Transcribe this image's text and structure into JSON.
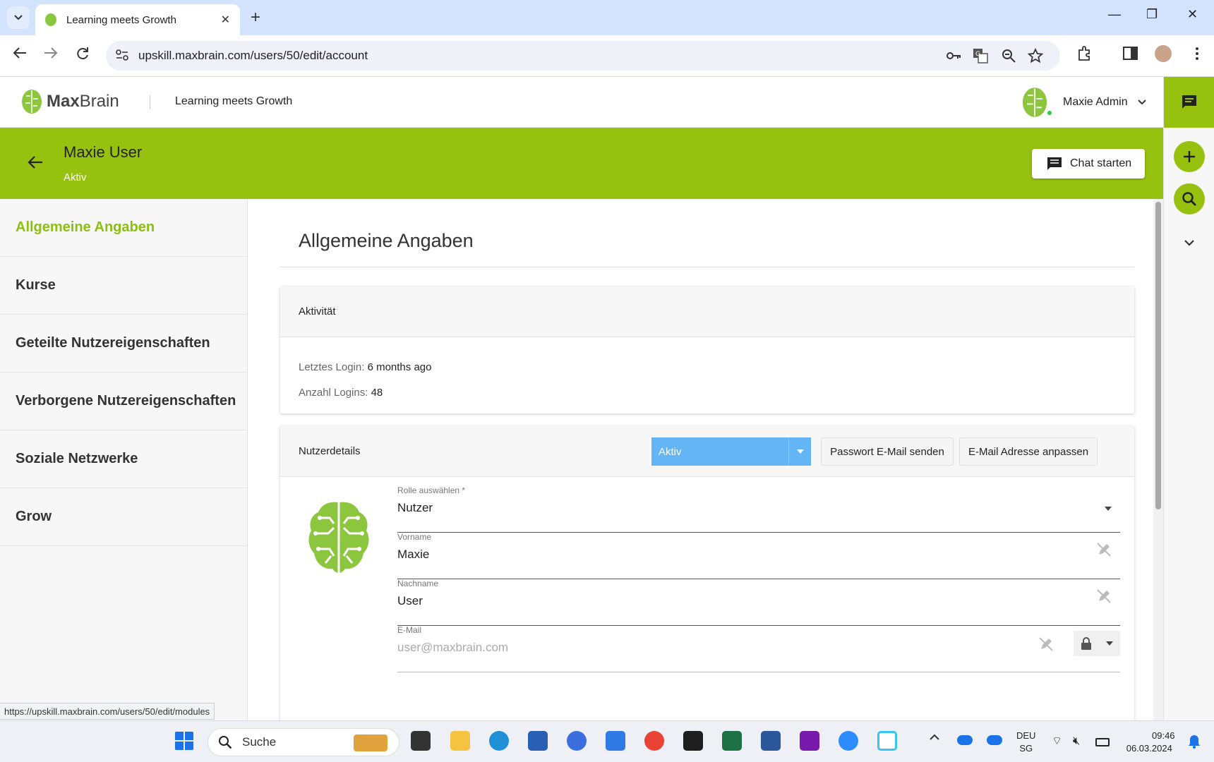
{
  "browser": {
    "tab_title": "Learning meets Growth",
    "url": "upskill.maxbrain.com/users/50/edit/account",
    "status_url": "https://upskill.maxbrain.com/users/50/edit/modules"
  },
  "header": {
    "logo_bold": "Max",
    "logo_rest": "Brain",
    "title": "Learning meets Growth",
    "user_name": "Maxie Admin"
  },
  "banner": {
    "name": "Maxie User",
    "status": "Aktiv",
    "chat_button": "Chat starten"
  },
  "sidebar": {
    "items": [
      {
        "label": "Allgemeine Angaben"
      },
      {
        "label": "Kurse"
      },
      {
        "label": "Geteilte Nutzereigenschaften"
      },
      {
        "label": "Verborgene Nutzereigenschaften"
      },
      {
        "label": "Soziale Netzwerke"
      },
      {
        "label": "Grow"
      }
    ]
  },
  "main": {
    "title": "Allgemeine Angaben",
    "activity": {
      "heading": "Aktivität",
      "last_login_label": "Letztes Login:",
      "last_login_value": "6 months ago",
      "login_count_label": "Anzahl Logins:",
      "login_count_value": "48"
    },
    "details": {
      "heading": "Nutzerdetails",
      "status_select": "Aktiv",
      "send_password_button": "Passwort E-Mail senden",
      "change_email_button": "E-Mail Adresse anpassen",
      "role_label": "Rolle auswählen *",
      "role_value": "Nutzer",
      "firstname_label": "Vorname",
      "firstname_value": "Maxie",
      "lastname_label": "Nachname",
      "lastname_value": "User",
      "email_label": "E-Mail",
      "email_value": "user@maxbrain.com"
    }
  },
  "taskbar": {
    "search_placeholder": "Suche",
    "lang_top": "DEU",
    "lang_bottom": "SG",
    "time": "09:46",
    "date": "06.03.2024"
  },
  "colors": {
    "brand_green": "#97c10f",
    "active_link": "#8cbf10",
    "select_blue": "#64b5f6"
  }
}
